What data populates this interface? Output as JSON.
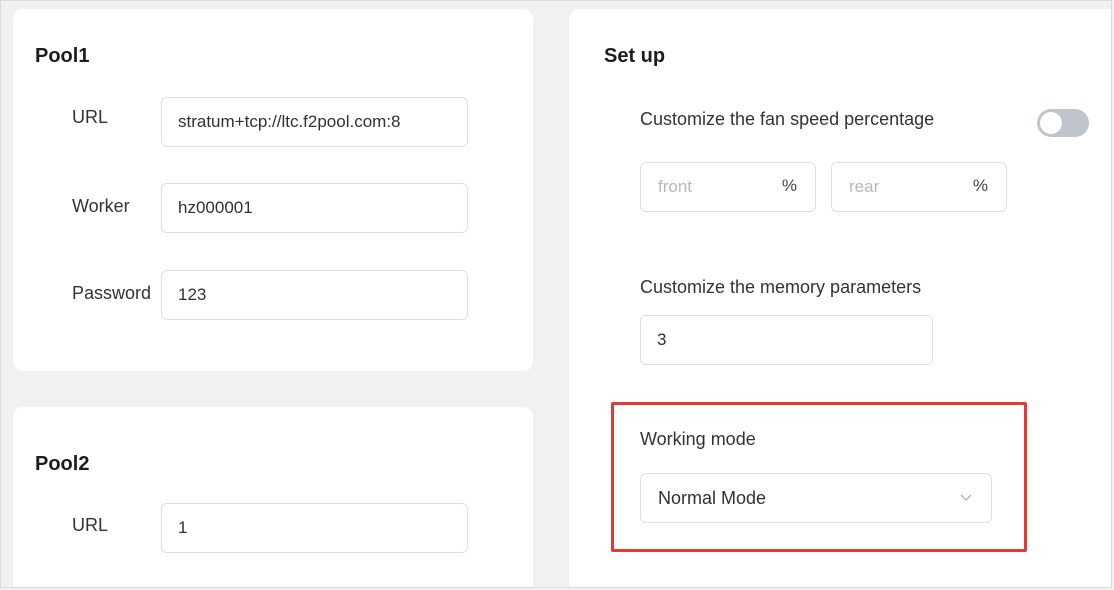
{
  "pool1": {
    "title": "Pool1",
    "url_label": "URL",
    "url_value": "stratum+tcp://ltc.f2pool.com:8",
    "worker_label": "Worker",
    "worker_value": "hz000001",
    "password_label": "Password",
    "password_value": "123"
  },
  "pool2": {
    "title": "Pool2",
    "url_label": "URL",
    "url_value": "1"
  },
  "setup": {
    "title": "Set up",
    "fan_label": "Customize the fan speed percentage",
    "fan_enabled": false,
    "front_placeholder": "front",
    "rear_placeholder": "rear",
    "percent_unit": "%",
    "memory_label": "Customize the memory parameters",
    "memory_value": "3",
    "working_mode_label": "Working mode",
    "working_mode_value": "Normal Mode"
  },
  "icons": {
    "select_arrow": "chevron-down-icon"
  },
  "colors": {
    "highlight": "#e53935",
    "toggle_off": "#c0c4cc",
    "panel_bg": "#f1f1f1",
    "card_bg": "#ffffff"
  }
}
